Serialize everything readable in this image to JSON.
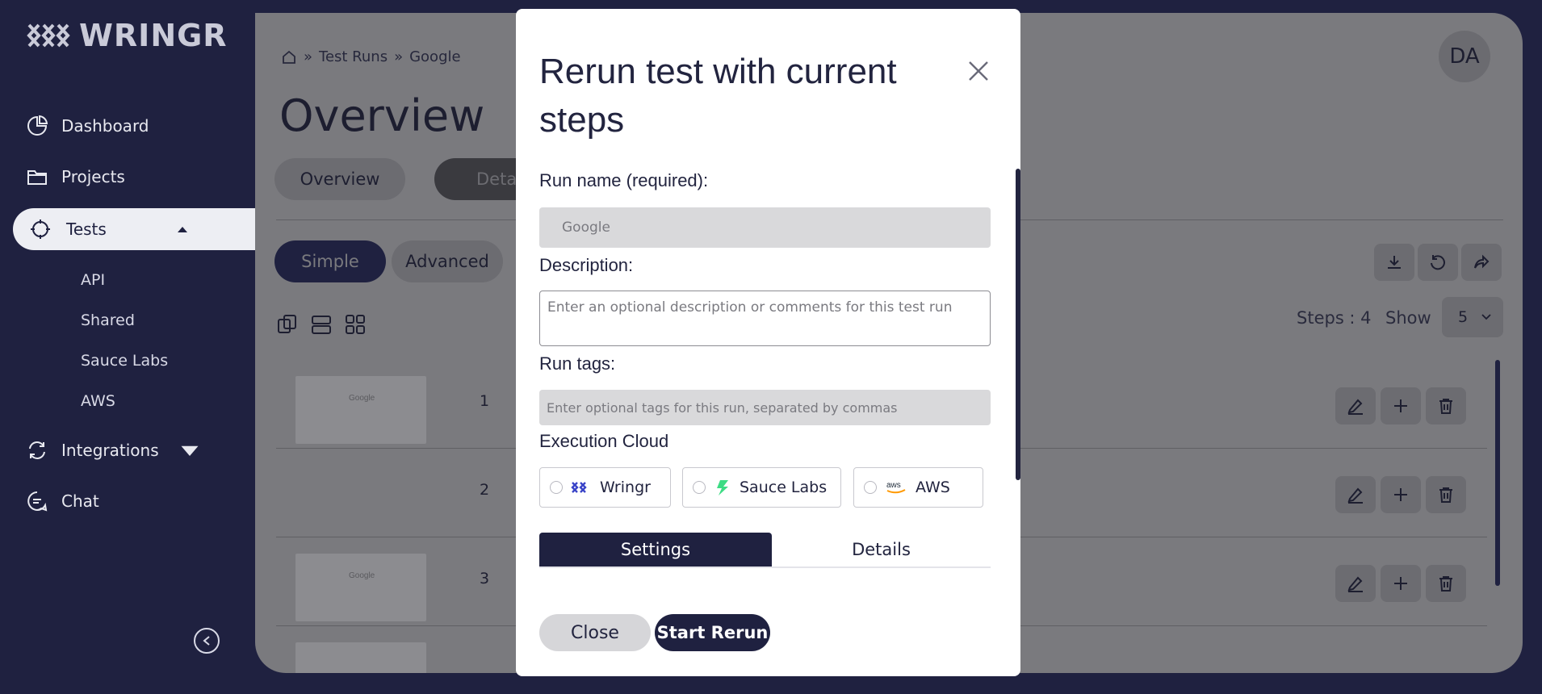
{
  "app": {
    "brand": "WRINGR"
  },
  "sidebar": {
    "items": [
      {
        "label": "Dashboard",
        "icon": "pie-chart-icon"
      },
      {
        "label": "Projects",
        "icon": "folder-icon"
      },
      {
        "label": "Tests",
        "icon": "crosshair-icon",
        "active": true
      },
      {
        "label": "Integrations",
        "icon": "refresh-icon"
      },
      {
        "label": "Chat",
        "icon": "chat-icon"
      }
    ],
    "subitems": [
      {
        "label": "API"
      },
      {
        "label": "Shared"
      },
      {
        "label": "Sauce Labs"
      },
      {
        "label": "AWS"
      }
    ]
  },
  "main": {
    "breadcrumb": [
      "Test Runs",
      "Google"
    ],
    "title": "Overview",
    "tabs": [
      {
        "label": "Overview"
      },
      {
        "label": "Deta"
      }
    ],
    "mode_tabs": [
      {
        "label": "Simple"
      },
      {
        "label": "Advanced"
      }
    ],
    "avatar": "DA",
    "steps_label": "Steps : 4",
    "show_label": "Show",
    "show_value": "5",
    "rows": [
      {
        "num": "1",
        "thumb": "Google"
      },
      {
        "num": "2",
        "thumb": ""
      },
      {
        "num": "3",
        "thumb": "Google"
      }
    ]
  },
  "modal": {
    "title": "Rerun test with current steps",
    "run_name_label": "Run name (required):",
    "run_name_value": "Google",
    "description_label": "Description:",
    "description_placeholder": "Enter an optional description or comments for this test run",
    "tags_label": "Run tags:",
    "tags_placeholder": "Enter optional tags for this run, separated by commas",
    "cloud_label": "Execution Cloud",
    "clouds": [
      {
        "label": "Wringr"
      },
      {
        "label": "Sauce Labs"
      },
      {
        "label": "AWS"
      }
    ],
    "tabs": [
      {
        "label": "Settings"
      },
      {
        "label": "Details"
      }
    ],
    "close_label": "Close",
    "start_label": "Start Rerun"
  },
  "colors": {
    "navy": "#1f2140",
    "overlay": "#7a7a7e",
    "white": "#ffffff"
  }
}
